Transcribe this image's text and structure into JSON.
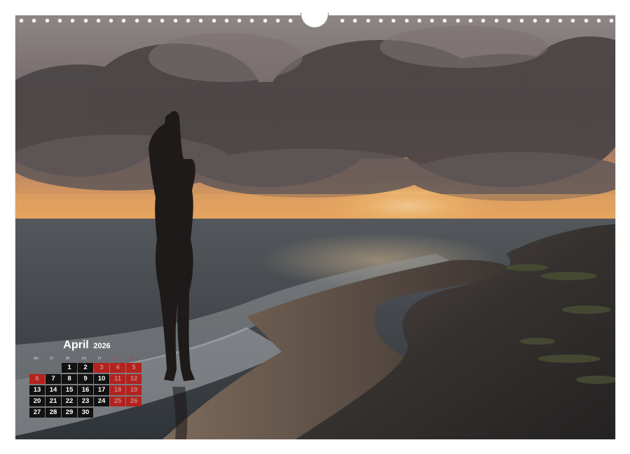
{
  "calendar": {
    "month": "April",
    "year": "2026",
    "weekdays": [
      "Mo",
      "Di",
      "Mi",
      "Do",
      "Fr",
      "Sa",
      "So"
    ],
    "weeks": [
      [
        "",
        "",
        "1",
        "2",
        "3",
        "4",
        "5"
      ],
      [
        "6",
        "7",
        "8",
        "9",
        "10",
        "11",
        "12"
      ],
      [
        "13",
        "14",
        "15",
        "16",
        "17",
        "18",
        "19"
      ],
      [
        "20",
        "21",
        "22",
        "23",
        "24",
        "25",
        "26"
      ],
      [
        "27",
        "28",
        "29",
        "30",
        "",
        "",
        ""
      ]
    ],
    "holidays": [
      "3",
      "6"
    ]
  },
  "colors": {
    "page": "#ffffff",
    "day_cell": "#111111",
    "weekend_cell": "#b3221d",
    "sky_sunset": "#e8a45a",
    "clouds": "#4b4546",
    "sea": "#3d4347",
    "sand": "#2d2b2b"
  }
}
